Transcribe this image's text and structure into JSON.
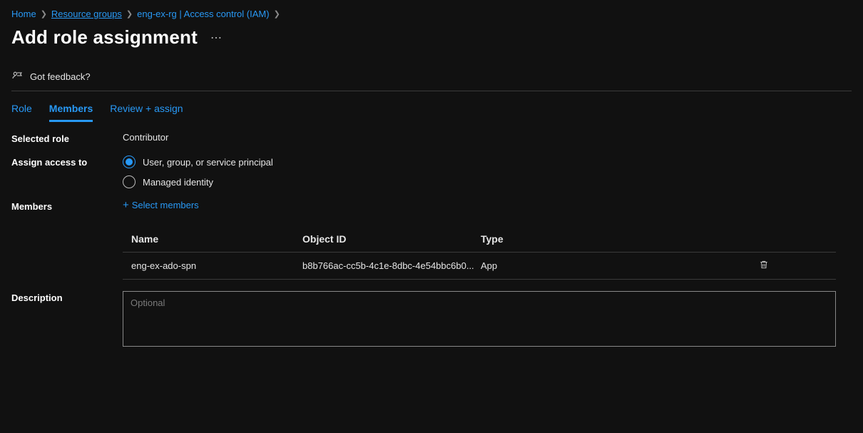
{
  "breadcrumbs": [
    {
      "label": "Home",
      "underline": false
    },
    {
      "label": "Resource groups",
      "underline": true
    },
    {
      "label": "eng-ex-rg | Access control (IAM)",
      "underline": false
    }
  ],
  "page_title": "Add role assignment",
  "feedback_label": "Got feedback?",
  "tabs": {
    "role": "Role",
    "members": "Members",
    "review": "Review + assign"
  },
  "form": {
    "selected_role_label": "Selected role",
    "selected_role_value": "Contributor",
    "assign_access_label": "Assign access to",
    "radio_user_group": "User, group, or service principal",
    "radio_managed_identity": "Managed identity",
    "members_label": "Members",
    "select_members": "Select members",
    "description_label": "Description",
    "description_placeholder": "Optional",
    "description_value": ""
  },
  "members_table": {
    "headers": {
      "name": "Name",
      "object_id": "Object ID",
      "type": "Type"
    },
    "rows": [
      {
        "name": "eng-ex-ado-spn",
        "object_id": "b8b766ac-cc5b-4c1e-8dbc-4e54bbc6b0...",
        "type": "App"
      }
    ]
  }
}
